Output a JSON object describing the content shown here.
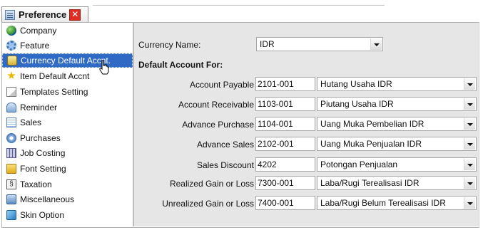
{
  "window": {
    "tab_title": "Preference",
    "close_glyph": "✕"
  },
  "sidebar": {
    "items": [
      {
        "label": "Company",
        "icon": "globe-icon"
      },
      {
        "label": "Feature",
        "icon": "gear-icon"
      },
      {
        "label": "Currency Default Accnt.",
        "icon": "currency-icon",
        "selected": true
      },
      {
        "label": "Item Default Accnt",
        "icon": "star-icon"
      },
      {
        "label": "Templates Setting",
        "icon": "template-icon"
      },
      {
        "label": "Reminder",
        "icon": "reminder-icon"
      },
      {
        "label": "Sales",
        "icon": "sales-icon"
      },
      {
        "label": "Purchases",
        "icon": "purchases-icon"
      },
      {
        "label": "Job Costing",
        "icon": "job-costing-icon"
      },
      {
        "label": "Font Setting",
        "icon": "font-folder-icon"
      },
      {
        "label": "Taxation",
        "icon": "taxation-icon"
      },
      {
        "label": "Miscellaneous",
        "icon": "miscellaneous-icon"
      },
      {
        "label": "Skin Option",
        "icon": "skin-icon"
      }
    ]
  },
  "form": {
    "currency_name_label": "Currency Name:",
    "currency_name_value": "IDR",
    "section_heading": "Default Account For:",
    "rows": [
      {
        "label": "Account Payable",
        "code": "2101-001",
        "account": "Hutang Usaha IDR"
      },
      {
        "label": "Account Receivable",
        "code": "1103-001",
        "account": "Piutang Usaha IDR"
      },
      {
        "label": "Advance Purchase",
        "code": "1104-001",
        "account": "Uang Muka Pembelian IDR"
      },
      {
        "label": "Advance Sales",
        "code": "2102-001",
        "account": "Uang Muka Penjualan IDR"
      },
      {
        "label": "Sales Discount",
        "code": "4202",
        "account": "Potongan Penjualan"
      },
      {
        "label": "Realized Gain or Loss",
        "code": "7300-001",
        "account": "Laba/Rugi Terealisasi IDR"
      },
      {
        "label": "Unrealized Gain or Loss",
        "code": "7400-001",
        "account": "Laba/Rugi Belum Terealisasi IDR"
      }
    ]
  },
  "colors": {
    "selection": "#316ac5",
    "close_button": "#e02b22",
    "form_background": "#e6e6e6"
  }
}
